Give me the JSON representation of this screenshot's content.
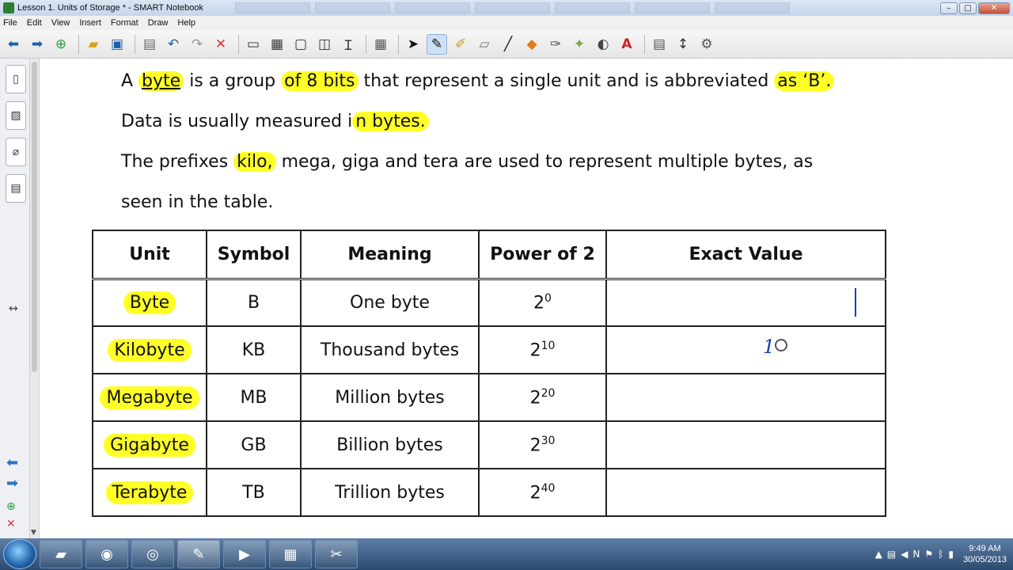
{
  "window": {
    "title": "Lesson 1. Units of Storage * - SMART Notebook",
    "minimize": "–",
    "maximize": "□",
    "close": "✕"
  },
  "menu": [
    "File",
    "Edit",
    "View",
    "Insert",
    "Format",
    "Draw",
    "Help"
  ],
  "toolbar_icons": [
    "back-arrow-icon",
    "forward-arrow-icon",
    "add-page-icon",
    "open-file-icon",
    "save-icon",
    "paste-icon",
    "undo-icon",
    "redo-icon",
    "delete-icon",
    "screen-shade-icon",
    "display-icon",
    "record-icon",
    "screen-capture-icon",
    "text-icon",
    "table-icon",
    "select-icon",
    "pen-icon",
    "creative-pen-icon",
    "eraser-icon",
    "line-icon",
    "shapes-icon",
    "magic-pen-icon",
    "fill-icon",
    "text-tool-icon",
    "properties-icon",
    "move-toolbar-icon"
  ],
  "slide": {
    "line1": {
      "a": "A ",
      "byte": "byte",
      "b": " is a group ",
      "of8bits": "of 8 bits",
      "c": " that represent a single unit and is abbreviated ",
      "asB": "as ‘B’."
    },
    "line2": {
      "a": "Data is usually measured i",
      "bytes": "n bytes."
    },
    "line3": {
      "a": "The prefixes ",
      "kilo": "kilo,",
      "b": " mega, giga and tera are used to represent multiple bytes, as"
    },
    "line4": "seen in the table."
  },
  "table": {
    "headers": [
      "Unit",
      "Symbol",
      "Meaning",
      "Power of 2",
      "Exact Value"
    ],
    "rows": [
      {
        "unit": "Byte",
        "symbol": "B",
        "meaning": "One byte",
        "base": "2",
        "exp": "0",
        "value": ""
      },
      {
        "unit": "Kilobyte",
        "symbol": "KB",
        "meaning": "Thousand bytes",
        "base": "2",
        "exp": "10",
        "value": ""
      },
      {
        "unit": "Megabyte",
        "symbol": "MB",
        "meaning": "Million bytes",
        "base": "2",
        "exp": "20",
        "value": ""
      },
      {
        "unit": "Gigabyte",
        "symbol": "GB",
        "meaning": "Billion bytes",
        "base": "2",
        "exp": "30",
        "value": ""
      },
      {
        "unit": "Terabyte",
        "symbol": "TB",
        "meaning": "Trillion bytes",
        "base": "2",
        "exp": "40",
        "value": ""
      }
    ],
    "handwriting": "1"
  },
  "colors": {
    "highlight": "#ffff26",
    "ink": "#1c3fa8"
  },
  "taskbar": {
    "apps": [
      "file-explorer-icon",
      "firefox-icon",
      "chrome-icon",
      "smart-notebook-icon",
      "media-player-icon",
      "calculator-icon",
      "snipping-tool-icon"
    ],
    "clock_time": "9:49 AM",
    "clock_date": "30/05/2013"
  }
}
